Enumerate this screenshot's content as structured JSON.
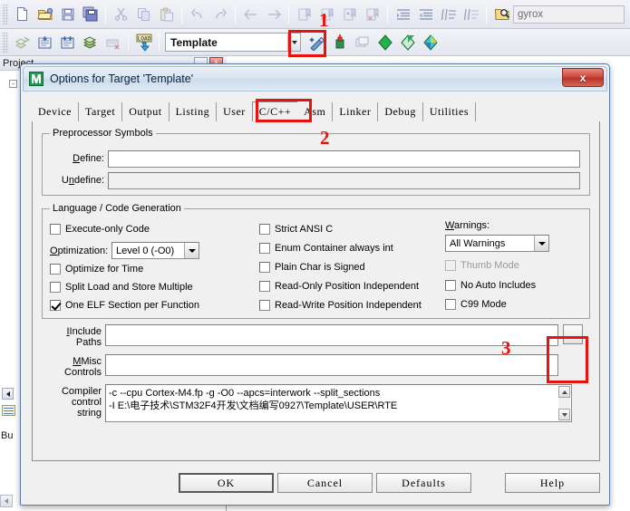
{
  "app": {
    "project_panel_title": "Project",
    "build_panel_title": "Bu",
    "tree_expander": "-"
  },
  "toolbar": {
    "row1": [
      {
        "name": "new-file-icon",
        "title": "New"
      },
      {
        "name": "open-file-icon",
        "title": "Open"
      },
      {
        "name": "save-icon",
        "title": "Save"
      },
      {
        "name": "save-all-icon",
        "title": "Save All"
      },
      {
        "name": "cut-icon",
        "title": "Cut"
      },
      {
        "name": "copy-icon",
        "title": "Copy"
      },
      {
        "name": "paste-icon",
        "title": "Paste"
      },
      {
        "name": "undo-icon",
        "title": "Undo"
      },
      {
        "name": "redo-icon",
        "title": "Redo"
      },
      {
        "name": "navigate-back-icon",
        "title": "Back"
      },
      {
        "name": "navigate-forward-icon",
        "title": "Forward"
      },
      {
        "name": "bookmark-toggle-icon",
        "title": "Insert/Remove Bookmark"
      },
      {
        "name": "bookmark-prev-icon",
        "title": "Previous Bookmark"
      },
      {
        "name": "bookmark-next-icon",
        "title": "Next Bookmark"
      },
      {
        "name": "bookmark-clear-icon",
        "title": "Clear All Bookmarks"
      },
      {
        "name": "indent-icon",
        "title": "Indent"
      },
      {
        "name": "outdent-icon",
        "title": "Outdent"
      },
      {
        "name": "comment-icon",
        "title": "Comment"
      },
      {
        "name": "uncomment-icon",
        "title": "Uncomment"
      },
      {
        "name": "find-in-files-icon",
        "title": "Find in Files"
      }
    ],
    "search_value": "gyrox",
    "search_placeholder": "",
    "row2": [
      {
        "name": "build-icon",
        "title": "Translate"
      },
      {
        "name": "build-target-icon",
        "title": "Build"
      },
      {
        "name": "rebuild-icon",
        "title": "Rebuild"
      },
      {
        "name": "batch-build-icon",
        "title": "Batch Build"
      },
      {
        "name": "stop-build-icon",
        "title": "Stop Build"
      },
      {
        "name": "download-icon",
        "title": "Download"
      }
    ],
    "target_value": "Template",
    "row2_right": [
      {
        "name": "target-options-icon",
        "title": "Options for Target"
      },
      {
        "name": "manage-components-icon",
        "title": "Manage Project Items"
      },
      {
        "name": "multi-project-icon",
        "title": "Manage Multi-Project"
      },
      {
        "name": "pack-installer-icon",
        "title": "Pack Installer"
      },
      {
        "name": "run-to-main-icon",
        "title": "Configure Flash Tools"
      },
      {
        "name": "manage-runtime-icon",
        "title": "Manage Run-Time Environment"
      }
    ]
  },
  "dialog": {
    "title": "Options for Target 'Template'",
    "icon_glyph": "☑",
    "close_label": "x",
    "tabs": [
      {
        "label": "Device",
        "active": false
      },
      {
        "label": "Target",
        "active": false
      },
      {
        "label": "Output",
        "active": false
      },
      {
        "label": "Listing",
        "active": false
      },
      {
        "label": "User",
        "active": false
      },
      {
        "label": "C/C++",
        "active": true
      },
      {
        "label": "Asm",
        "active": false
      },
      {
        "label": "Linker",
        "active": false
      },
      {
        "label": "Debug",
        "active": false
      },
      {
        "label": "Utilities",
        "active": false
      }
    ],
    "preprocessor": {
      "group_title": "Preprocessor Symbols",
      "define_label": "Define:",
      "define_value": "",
      "undefine_label": "Undefine:",
      "undefine_value": ""
    },
    "language": {
      "group_title": "Language / Code Generation",
      "col1": [
        {
          "label": "Execute-only Code",
          "checked": false,
          "disabled": false
        },
        {
          "label": "Optimize for Time",
          "checked": false,
          "disabled": false
        },
        {
          "label": "Split Load and Store Multiple",
          "checked": false,
          "disabled": false
        },
        {
          "label": "One ELF Section per Function",
          "checked": true,
          "disabled": false
        }
      ],
      "optimization_label": "Optimization:",
      "optimization_value": "Level 0 (-O0)",
      "col2": [
        {
          "label": "Strict ANSI C",
          "checked": false,
          "disabled": false
        },
        {
          "label": "Enum Container always int",
          "checked": false,
          "disabled": false
        },
        {
          "label": "Plain Char is Signed",
          "checked": false,
          "disabled": false
        },
        {
          "label": "Read-Only Position Independent",
          "checked": false,
          "disabled": false
        },
        {
          "label": "Read-Write Position Independent",
          "checked": false,
          "disabled": false
        }
      ],
      "warnings_label": "Warnings:",
      "warnings_value": "All Warnings",
      "col3": [
        {
          "label": "Thumb Mode",
          "checked": false,
          "disabled": true
        },
        {
          "label": "No Auto Includes",
          "checked": false,
          "disabled": false
        },
        {
          "label": "C99 Mode",
          "checked": false,
          "disabled": false
        }
      ]
    },
    "paths": {
      "include_label_line1": "Include",
      "include_label_line2": "Paths",
      "include_value": "",
      "browse_label": "...",
      "misc_label_line1": "Misc",
      "misc_label_line2": "Controls",
      "misc_value": "",
      "compiler_label_line1": "Compiler",
      "compiler_label_line2": "control",
      "compiler_label_line3": "string",
      "compiler_value_line1": "-c --cpu Cortex-M4.fp -g -O0 --apcs=interwork --split_sections",
      "compiler_value_line2": "-I E:\\电子技术\\STM32F4开发\\文档编写0927\\Template\\USER\\RTE"
    },
    "buttons": {
      "ok": "OK",
      "cancel": "Cancel",
      "defaults": "Defaults",
      "help": "Help"
    }
  },
  "annotations": [
    {
      "number": "1",
      "target": "target-options-toolbar-button"
    },
    {
      "number": "2",
      "target": "cc-tab"
    },
    {
      "number": "3",
      "target": "include-paths-browse-button"
    }
  ],
  "colors": {
    "annotation_red": "#e8120f",
    "dialog_face": "#f0f0f0",
    "titlebar_blue": "#ccdcec",
    "close_red": "#b8352a"
  }
}
